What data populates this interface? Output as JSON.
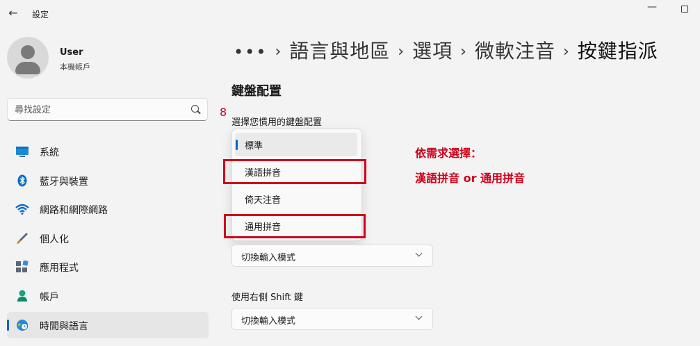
{
  "window": {
    "title": "設定",
    "back": "←",
    "minimize": "—"
  },
  "user": {
    "name": "User",
    "account_type": "本機帳戶"
  },
  "search": {
    "placeholder": "尋找設定"
  },
  "sidebar": {
    "items": [
      {
        "label": "系統",
        "icon": "system-icon",
        "color": "#0078d4"
      },
      {
        "label": "藍牙與裝置",
        "icon": "bluetooth-icon",
        "color": "#0078d4"
      },
      {
        "label": "網路和網際網路",
        "icon": "wifi-icon",
        "color": "#0067c0"
      },
      {
        "label": "個人化",
        "icon": "brush-icon",
        "color": "#c27c2c"
      },
      {
        "label": "應用程式",
        "icon": "apps-icon",
        "color": "#4a5a6a"
      },
      {
        "label": "帳戶",
        "icon": "account-icon",
        "color": "#1aa37a"
      },
      {
        "label": "時間與語言",
        "icon": "globe-clock-icon",
        "color": "#0078d4",
        "selected": true
      }
    ]
  },
  "breadcrumb": {
    "more": "•••",
    "items": [
      "語言與地區",
      "選項",
      "微軟注音",
      "按鍵指派"
    ],
    "separator": "›"
  },
  "main": {
    "section_title": "鍵盤配置",
    "step_number": "8",
    "keyboard_label": "選擇您慣用的鍵盤配置",
    "options": [
      {
        "label": "標準",
        "selected": true
      },
      {
        "label": "漢語拼音",
        "highlighted": true
      },
      {
        "label": "倚天注音"
      },
      {
        "label": "通用拼音",
        "highlighted": true
      }
    ],
    "annotation_line1": "依需求選擇：",
    "annotation_line2": "漢語拼音 or 通用拼音",
    "combo1_value": "切換輸入模式",
    "right_shift_label": "使用右側 Shift 鍵",
    "combo2_value": "切換輸入模式"
  },
  "colors": {
    "accent": "#0067c0",
    "annotation": "#d0021b"
  }
}
